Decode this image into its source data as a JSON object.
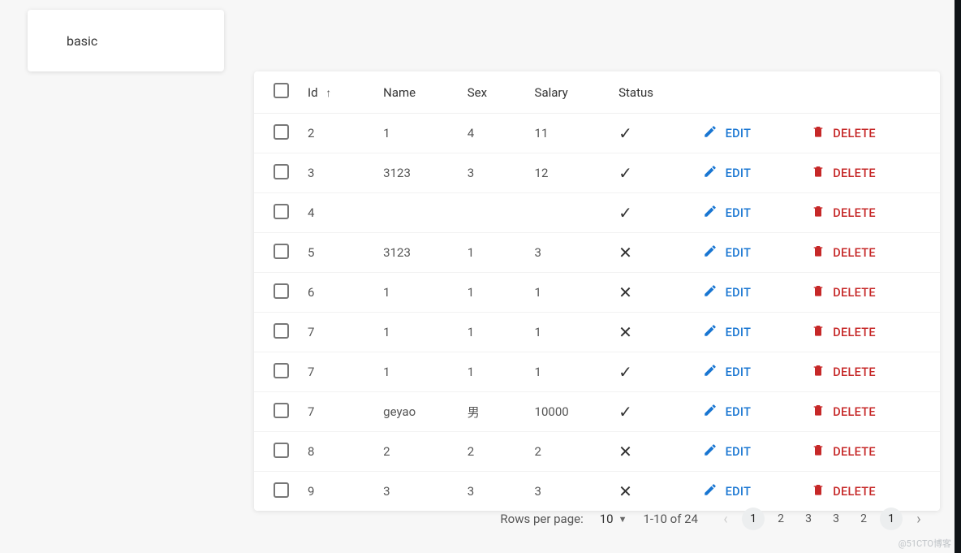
{
  "card": {
    "title": "basic"
  },
  "table": {
    "headers": {
      "id": "Id",
      "name": "Name",
      "sex": "Sex",
      "salary": "Salary",
      "status": "Status"
    },
    "sort": {
      "column": "id",
      "direction": "asc_glyph",
      "glyph": "↑"
    },
    "rows": [
      {
        "id": "2",
        "name": "1",
        "sex": "4",
        "salary": "11",
        "status": true
      },
      {
        "id": "3",
        "name": "3123",
        "sex": "3",
        "salary": "12",
        "status": true
      },
      {
        "id": "4",
        "name": "",
        "sex": "",
        "salary": "",
        "status": true
      },
      {
        "id": "5",
        "name": "3123",
        "sex": "1",
        "salary": "3",
        "status": false
      },
      {
        "id": "6",
        "name": "1",
        "sex": "1",
        "salary": "1",
        "status": false
      },
      {
        "id": "7",
        "name": "1",
        "sex": "1",
        "salary": "1",
        "status": false
      },
      {
        "id": "7",
        "name": "1",
        "sex": "1",
        "salary": "1",
        "status": true
      },
      {
        "id": "7",
        "name": "geyao",
        "sex": "男",
        "salary": "10000",
        "status": true
      },
      {
        "id": "8",
        "name": "2",
        "sex": "2",
        "salary": "2",
        "status": false
      },
      {
        "id": "9",
        "name": "3",
        "sex": "3",
        "salary": "3",
        "status": false
      }
    ],
    "actions": {
      "edit_label": "EDIT",
      "delete_label": "DELETE"
    }
  },
  "pagination": {
    "rows_per_page_label": "Rows per page:",
    "rows_per_page_value": "10",
    "range_text": "1-10 of 24",
    "pages": [
      "1",
      "2",
      "3"
    ],
    "current_page": "1"
  },
  "watermark": "@51CTO博客"
}
